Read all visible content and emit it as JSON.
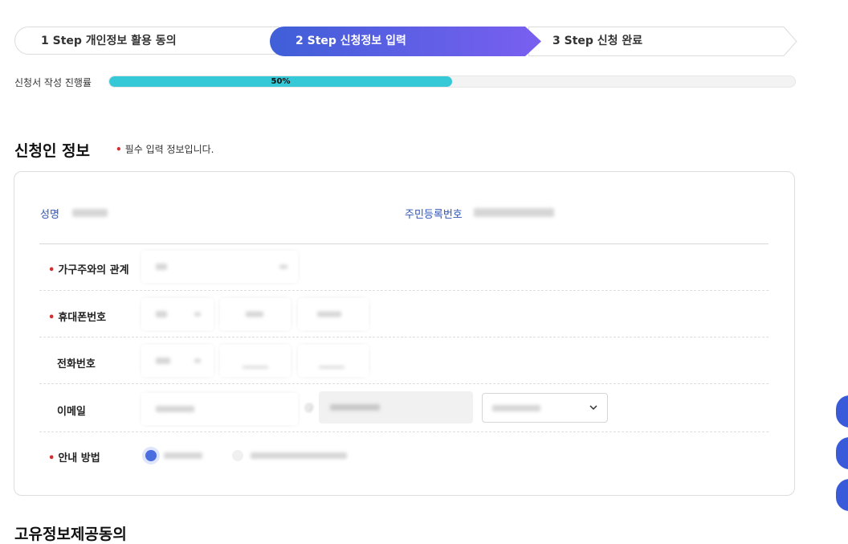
{
  "steps": [
    {
      "label": "1 Step 개인정보 활용 동의"
    },
    {
      "label": "2 Step 신청정보 입력"
    },
    {
      "label": "3 Step 신청 완료"
    }
  ],
  "progress": {
    "label": "신청서 작성 진행률",
    "value_text": "50%",
    "fraction": 0.5
  },
  "section": {
    "title": "신청인 정보",
    "required_note": "필수 입력 정보입니다."
  },
  "applicant": {
    "name_label": "성명",
    "rrn_label": "주민등록번호"
  },
  "rows": [
    {
      "label": "가구주와의 관계",
      "required": true
    },
    {
      "label": "휴대폰번호",
      "required": true
    },
    {
      "label": "전화번호",
      "required": false
    },
    {
      "label": "이메일",
      "required": false
    },
    {
      "label": "안내 방법",
      "required": true
    }
  ],
  "email": {
    "at_symbol": "@"
  },
  "required_mark": "•",
  "next_section": {
    "title": "고유정보제공동의"
  },
  "colors": {
    "accent": "#3a5bd9",
    "progress": "#35c8d6",
    "required": "#d32f2f",
    "step_active_from": "#3f5fd8",
    "step_active_to": "#7a5ff0"
  }
}
